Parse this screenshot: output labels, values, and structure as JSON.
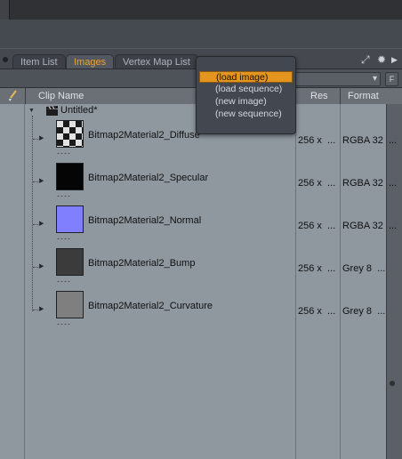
{
  "tabs": [
    {
      "label": "Item List",
      "active": false
    },
    {
      "label": "Images",
      "active": true
    },
    {
      "label": "Vertex Map List",
      "active": false
    }
  ],
  "top_icons": [
    "expand-icon",
    "gear-icon",
    "arrow-right-icon"
  ],
  "filter_button_label": "F",
  "columns": {
    "edit_icon": "brush-icon",
    "clip_name": "Clip Name",
    "res": "Res",
    "format": "Format"
  },
  "root_item": {
    "icon": "clapperboard-icon",
    "label": "Untitled*"
  },
  "clips": [
    {
      "name": "Bitmap2Material2_Diffuse",
      "res": "256 x",
      "res_more": "...",
      "format": "RGBA 32",
      "format_more": "...",
      "thumb_color": "checker"
    },
    {
      "name": "Bitmap2Material2_Specular",
      "res": "256 x",
      "res_more": "...",
      "format": "RGBA 32",
      "format_more": "...",
      "thumb_color": "#050505"
    },
    {
      "name": "Bitmap2Material2_Normal",
      "res": "256 x",
      "res_more": "...",
      "format": "RGBA 32",
      "format_more": "...",
      "thumb_color": "#8080fe"
    },
    {
      "name": "Bitmap2Material2_Bump",
      "res": "256 x",
      "res_more": "...",
      "format": "Grey 8",
      "format_more": "...",
      "thumb_color": "#3b3b3b"
    },
    {
      "name": "Bitmap2Material2_Curvature",
      "res": "256 x",
      "res_more": "...",
      "format": "Grey 8",
      "format_more": "...",
      "thumb_color": "#7f7f7f"
    }
  ],
  "thumb_caption": "----",
  "popup_menu": {
    "items": [
      {
        "label": "(load image)",
        "selected": true
      },
      {
        "label": "(load sequence)",
        "selected": false
      },
      {
        "label": "(new image)",
        "selected": false
      },
      {
        "label": "(new sequence)",
        "selected": false
      }
    ]
  },
  "colors": {
    "accent": "#e3951f",
    "active_tab_text": "#e9a23a",
    "list_background": "#8f979f"
  }
}
